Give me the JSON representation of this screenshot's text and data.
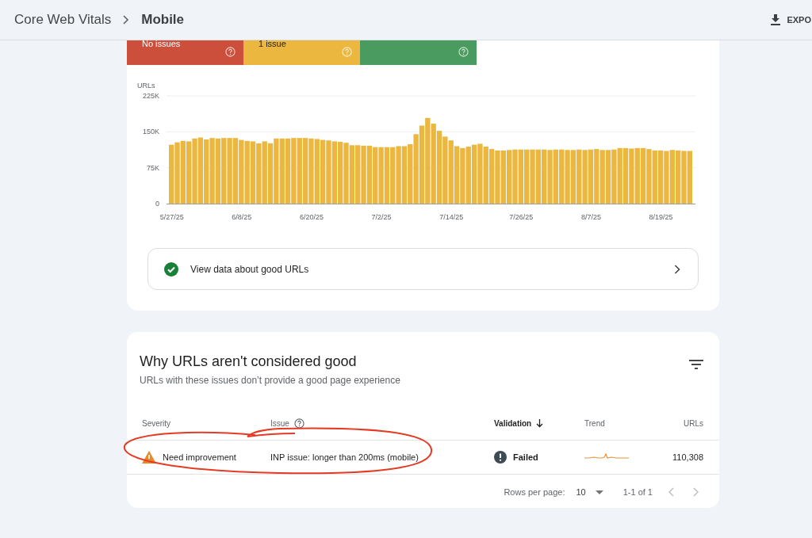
{
  "breadcrumb": [
    {
      "label": "Core Web Vitals"
    },
    {
      "label": "Mobile"
    }
  ],
  "export_button": {
    "label": "EXPO"
  },
  "status_summary": [
    {
      "label": "No issues",
      "color": "#cc4f3c"
    },
    {
      "label": "1 issue",
      "color": "#ebb73f"
    },
    {
      "color": "#4a9b5f"
    }
  ],
  "chart": {
    "chart_data": {
      "type": "bar",
      "ylabel": "URLs",
      "categories": [
        "5/27/25",
        null,
        null,
        null,
        null,
        null,
        null,
        null,
        null,
        null,
        null,
        null,
        "6/8/25",
        null,
        null,
        null,
        null,
        null,
        null,
        null,
        null,
        null,
        null,
        null,
        "6/20/25",
        null,
        null,
        null,
        null,
        null,
        null,
        null,
        null,
        null,
        null,
        null,
        "7/2/25",
        null,
        null,
        null,
        null,
        null,
        null,
        null,
        null,
        null,
        null,
        null,
        "7/14/25",
        null,
        null,
        null,
        null,
        null,
        null,
        null,
        null,
        null,
        null,
        null,
        "7/26/25",
        null,
        null,
        null,
        null,
        null,
        null,
        null,
        null,
        null,
        null,
        null,
        "8/7/25",
        null,
        null,
        null,
        null,
        null,
        null,
        null,
        null,
        null,
        null,
        null,
        "8/19/25",
        null,
        null,
        null,
        null,
        null
      ],
      "series": [
        {
          "color": "#ebb73f",
          "values": [
            123000,
            128000,
            131000,
            130000,
            136000,
            138000,
            134000,
            137000,
            136000,
            137000,
            137000,
            137000,
            133000,
            131000,
            130000,
            126000,
            130000,
            126000,
            136000,
            136000,
            136000,
            137000,
            137000,
            137000,
            136000,
            135000,
            133000,
            132000,
            130000,
            129000,
            127000,
            122000,
            122000,
            121000,
            121000,
            118000,
            118000,
            118000,
            118000,
            120000,
            120000,
            124000,
            145000,
            163000,
            179000,
            167000,
            152000,
            140000,
            132000,
            120000,
            116000,
            119000,
            123000,
            125000,
            119000,
            114000,
            111000,
            111000,
            112000,
            113000,
            113000,
            113000,
            113000,
            113000,
            113000,
            112000,
            113000,
            113000,
            112000,
            112000,
            113000,
            112000,
            113000,
            114000,
            112000,
            112000,
            113000,
            116000,
            116000,
            115000,
            116000,
            116000,
            114000,
            111000,
            111000,
            110000,
            112000,
            111000,
            110000,
            110000
          ]
        }
      ],
      "ylim": [
        0,
        225000
      ],
      "yticks": [
        {
          "value": 0,
          "label": "0"
        },
        {
          "value": 75000,
          "label": "75K"
        },
        {
          "value": 150000,
          "label": "150K"
        },
        {
          "value": 225000,
          "label": "225K"
        }
      ]
    }
  },
  "good_urls_link": {
    "label": "View data about good URLs"
  },
  "issues_card": {
    "title": "Why URLs aren't considered good",
    "subtitle": "URLs with these issues don’t provide a good page experience",
    "columns": [
      {
        "label": "Severity",
        "help": false,
        "sorted": false
      },
      {
        "label": "Issue",
        "help": true,
        "sorted": false
      },
      {
        "label": "Validation",
        "help": false,
        "sorted": true
      },
      {
        "label": "Trend",
        "help": false,
        "sorted": false
      },
      {
        "label": "URLs",
        "help": false,
        "sorted": false
      }
    ],
    "rows": [
      {
        "severity": "Need improvement",
        "issue": "INP issue: longer than 200ms (mobile)",
        "validation": "Failed",
        "urls": "110,308",
        "circled": true
      }
    ],
    "pagination": {
      "rows_per_page_label": "Rows per page:",
      "rows_per_page": "10",
      "range": "1-1 of 1"
    }
  }
}
